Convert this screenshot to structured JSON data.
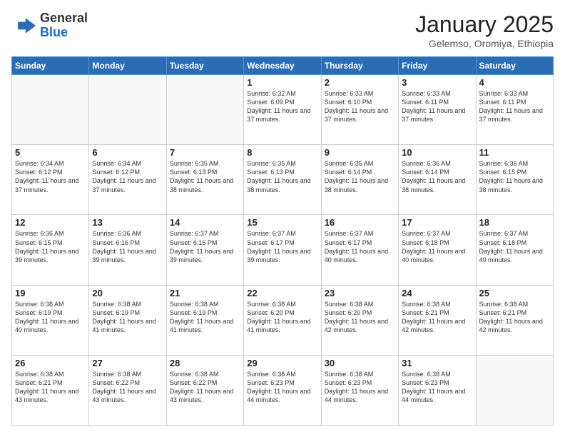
{
  "logo": {
    "general": "General",
    "blue": "Blue"
  },
  "header": {
    "month": "January 2025",
    "location": "Gelemso, Oromiya, Ethiopia"
  },
  "days_of_week": [
    "Sunday",
    "Monday",
    "Tuesday",
    "Wednesday",
    "Thursday",
    "Friday",
    "Saturday"
  ],
  "weeks": [
    [
      {
        "day": "",
        "info": ""
      },
      {
        "day": "",
        "info": ""
      },
      {
        "day": "",
        "info": ""
      },
      {
        "day": "1",
        "info": "Sunrise: 6:32 AM\nSunset: 6:09 PM\nDaylight: 11 hours and 37 minutes."
      },
      {
        "day": "2",
        "info": "Sunrise: 6:33 AM\nSunset: 6:10 PM\nDaylight: 11 hours and 37 minutes."
      },
      {
        "day": "3",
        "info": "Sunrise: 6:33 AM\nSunset: 6:11 PM\nDaylight: 11 hours and 37 minutes."
      },
      {
        "day": "4",
        "info": "Sunrise: 6:33 AM\nSunset: 6:11 PM\nDaylight: 11 hours and 37 minutes."
      }
    ],
    [
      {
        "day": "5",
        "info": "Sunrise: 6:34 AM\nSunset: 6:12 PM\nDaylight: 11 hours and 37 minutes."
      },
      {
        "day": "6",
        "info": "Sunrise: 6:34 AM\nSunset: 6:12 PM\nDaylight: 11 hours and 37 minutes."
      },
      {
        "day": "7",
        "info": "Sunrise: 6:35 AM\nSunset: 6:13 PM\nDaylight: 11 hours and 38 minutes."
      },
      {
        "day": "8",
        "info": "Sunrise: 6:35 AM\nSunset: 6:13 PM\nDaylight: 11 hours and 38 minutes."
      },
      {
        "day": "9",
        "info": "Sunrise: 6:35 AM\nSunset: 6:14 PM\nDaylight: 11 hours and 38 minutes."
      },
      {
        "day": "10",
        "info": "Sunrise: 6:36 AM\nSunset: 6:14 PM\nDaylight: 11 hours and 38 minutes."
      },
      {
        "day": "11",
        "info": "Sunrise: 6:36 AM\nSunset: 6:15 PM\nDaylight: 11 hours and 38 minutes."
      }
    ],
    [
      {
        "day": "12",
        "info": "Sunrise: 6:36 AM\nSunset: 6:15 PM\nDaylight: 11 hours and 39 minutes."
      },
      {
        "day": "13",
        "info": "Sunrise: 6:36 AM\nSunset: 6:16 PM\nDaylight: 11 hours and 39 minutes."
      },
      {
        "day": "14",
        "info": "Sunrise: 6:37 AM\nSunset: 6:16 PM\nDaylight: 11 hours and 39 minutes."
      },
      {
        "day": "15",
        "info": "Sunrise: 6:37 AM\nSunset: 6:17 PM\nDaylight: 11 hours and 39 minutes."
      },
      {
        "day": "16",
        "info": "Sunrise: 6:37 AM\nSunset: 6:17 PM\nDaylight: 11 hours and 40 minutes."
      },
      {
        "day": "17",
        "info": "Sunrise: 6:37 AM\nSunset: 6:18 PM\nDaylight: 11 hours and 40 minutes."
      },
      {
        "day": "18",
        "info": "Sunrise: 6:37 AM\nSunset: 6:18 PM\nDaylight: 11 hours and 40 minutes."
      }
    ],
    [
      {
        "day": "19",
        "info": "Sunrise: 6:38 AM\nSunset: 6:19 PM\nDaylight: 11 hours and 40 minutes."
      },
      {
        "day": "20",
        "info": "Sunrise: 6:38 AM\nSunset: 6:19 PM\nDaylight: 11 hours and 41 minutes."
      },
      {
        "day": "21",
        "info": "Sunrise: 6:38 AM\nSunset: 6:19 PM\nDaylight: 11 hours and 41 minutes."
      },
      {
        "day": "22",
        "info": "Sunrise: 6:38 AM\nSunset: 6:20 PM\nDaylight: 11 hours and 41 minutes."
      },
      {
        "day": "23",
        "info": "Sunrise: 6:38 AM\nSunset: 6:20 PM\nDaylight: 11 hours and 42 minutes."
      },
      {
        "day": "24",
        "info": "Sunrise: 6:38 AM\nSunset: 6:21 PM\nDaylight: 11 hours and 42 minutes."
      },
      {
        "day": "25",
        "info": "Sunrise: 6:38 AM\nSunset: 6:21 PM\nDaylight: 11 hours and 42 minutes."
      }
    ],
    [
      {
        "day": "26",
        "info": "Sunrise: 6:38 AM\nSunset: 6:21 PM\nDaylight: 11 hours and 43 minutes."
      },
      {
        "day": "27",
        "info": "Sunrise: 6:38 AM\nSunset: 6:22 PM\nDaylight: 11 hours and 43 minutes."
      },
      {
        "day": "28",
        "info": "Sunrise: 6:38 AM\nSunset: 6:22 PM\nDaylight: 11 hours and 43 minutes."
      },
      {
        "day": "29",
        "info": "Sunrise: 6:38 AM\nSunset: 6:23 PM\nDaylight: 11 hours and 44 minutes."
      },
      {
        "day": "30",
        "info": "Sunrise: 6:38 AM\nSunset: 6:23 PM\nDaylight: 11 hours and 44 minutes."
      },
      {
        "day": "31",
        "info": "Sunrise: 6:38 AM\nSunset: 6:23 PM\nDaylight: 11 hours and 44 minutes."
      },
      {
        "day": "",
        "info": ""
      }
    ]
  ]
}
